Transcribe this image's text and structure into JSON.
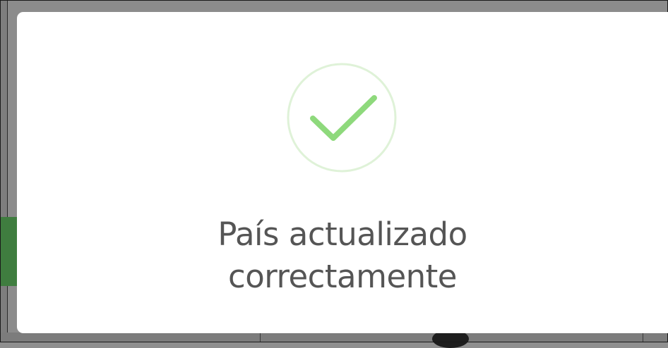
{
  "dialog": {
    "icon": "success-check-icon",
    "message_line_1": "País actualizado",
    "message_line_2": "correctamente"
  },
  "colors": {
    "success_green": "#8ed97c",
    "success_ring": "#dff2d8",
    "text": "#555555",
    "overlay": "#8c8c8c",
    "accent_green": "#3f7d3f"
  }
}
